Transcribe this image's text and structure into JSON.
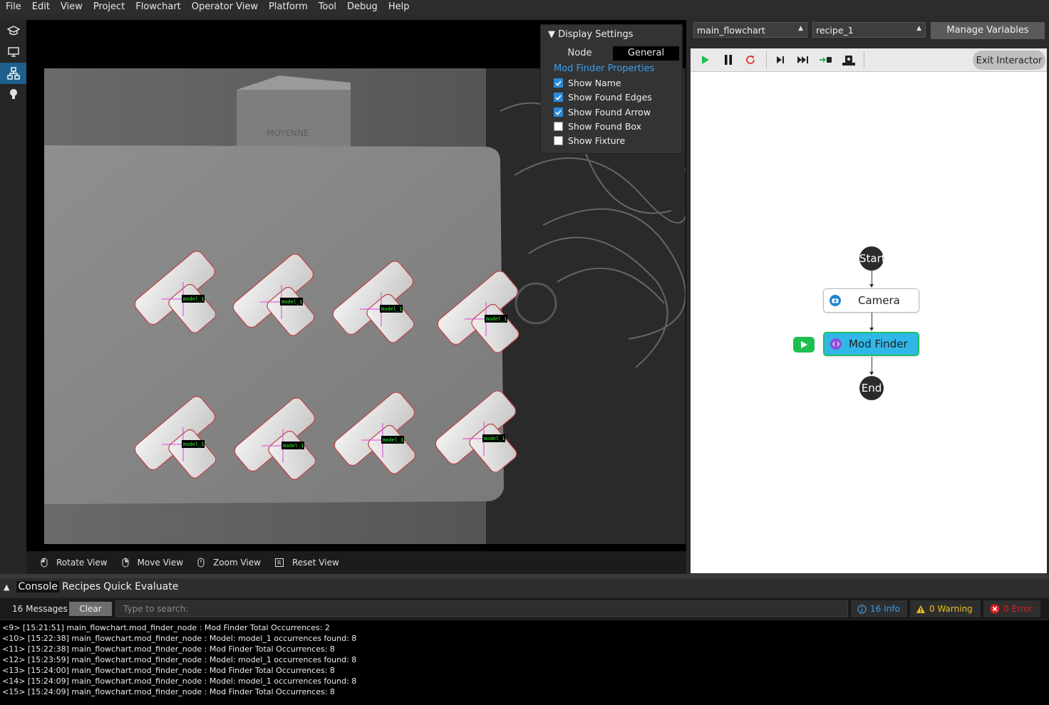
{
  "menu": [
    "File",
    "Edit",
    "View",
    "Project",
    "Flowchart",
    "Operator View",
    "Platform",
    "Tool",
    "Debug",
    "Help"
  ],
  "viewer": {
    "footer": {
      "rotate": "Rotate View",
      "move": "Move View",
      "zoom": "Zoom View",
      "reset": "Reset View"
    },
    "detections": [
      {
        "label": "model_1"
      },
      {
        "label": "model_1"
      },
      {
        "label": "model_1"
      },
      {
        "label": "model_1"
      },
      {
        "label": "model_1"
      },
      {
        "label": "model_1"
      },
      {
        "label": "model_1"
      },
      {
        "label": "model_1"
      }
    ],
    "box_text": "MOYENNE"
  },
  "display_settings": {
    "title": "Display Settings",
    "tabs": [
      "Node",
      "General"
    ],
    "active_tab": "General",
    "section": "Mod Finder Properties",
    "options": [
      {
        "label": "Show Name",
        "checked": true
      },
      {
        "label": "Show Found Edges",
        "checked": true
      },
      {
        "label": "Show Found Arrow",
        "checked": true
      },
      {
        "label": "Show Found Box",
        "checked": false
      },
      {
        "label": "Show Fixture",
        "checked": false
      }
    ]
  },
  "right_panel": {
    "flowchart_select": "main_flowchart",
    "recipe_select": "recipe_1",
    "manage_vars": "Manage Variables",
    "exit_interactor": "Exit Interactor",
    "nodes": {
      "start": "Start",
      "camera": "Camera",
      "mod_finder": "Mod Finder",
      "end": "End"
    }
  },
  "console": {
    "tabs": [
      "Console",
      "Recipes",
      "Quick Evaluate"
    ],
    "message_count": "16 Messages",
    "clear": "Clear",
    "search_placeholder": "Type to search:",
    "info": "16 Info",
    "warning": "0 Warning",
    "error": "0 Error",
    "lines": [
      "<9> [15:21:51] main_flowchart.mod_finder_node : Mod Finder Total Occurrences: 2",
      "<10> [15:22:38] main_flowchart.mod_finder_node : Model: model_1 occurrences found: 8",
      "<11> [15:22:38] main_flowchart.mod_finder_node : Mod Finder Total Occurrences: 8",
      "<12> [15:23:59] main_flowchart.mod_finder_node : Model: model_1 occurrences found: 8",
      "<13> [15:24:00] main_flowchart.mod_finder_node : Mod Finder Total Occurrences: 8",
      "<14> [15:24:09] main_flowchart.mod_finder_node : Model: model_1 occurrences found: 8",
      "<15> [15:24:09] main_flowchart.mod_finder_node : Mod Finder Total Occurrences: 8"
    ]
  },
  "colors": {
    "accent_blue": "#2d89d6",
    "active_node": "#2fb7ea",
    "active_border": "#20c060",
    "play_green": "#1fbf4f",
    "restart_red": "#e03030",
    "warning_yellow": "#e8c020",
    "error_red": "#e02020"
  }
}
